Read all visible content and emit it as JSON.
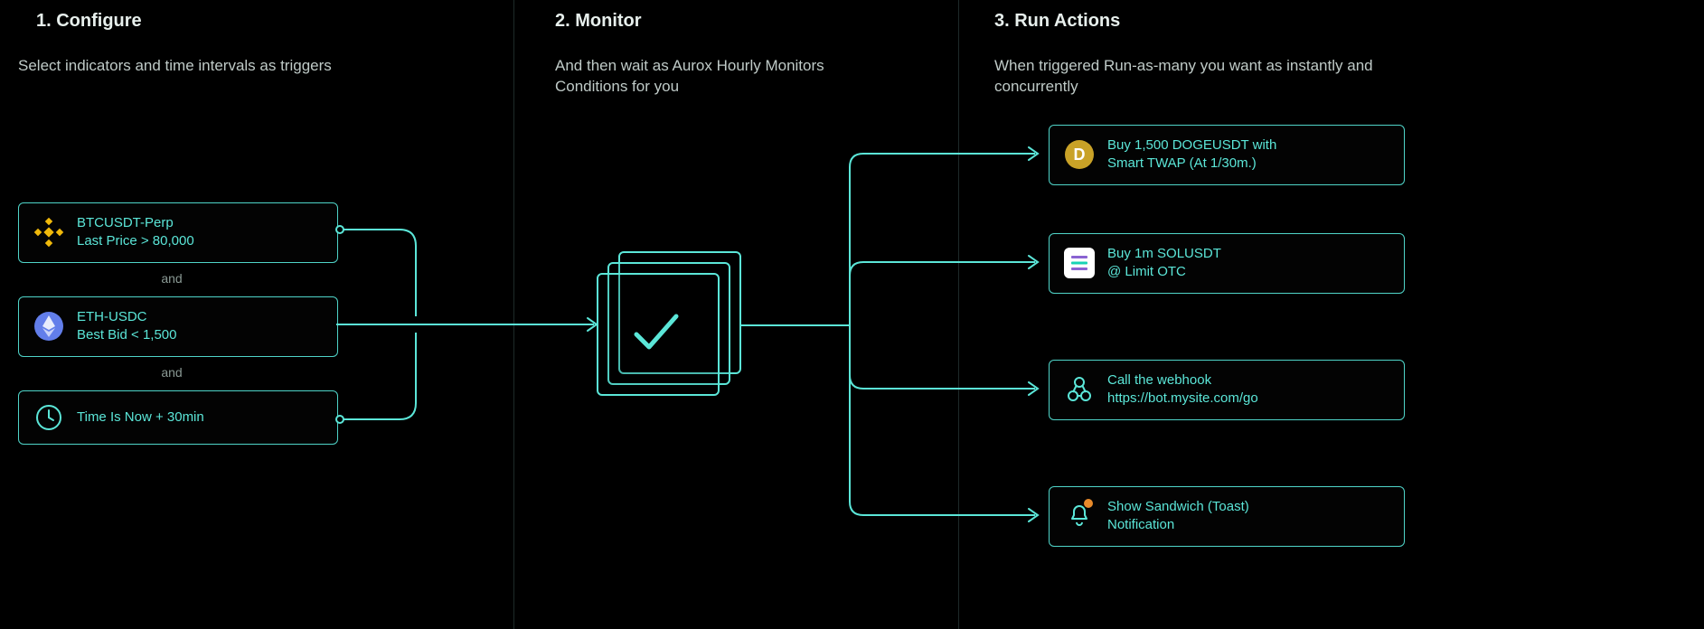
{
  "columns": {
    "c1": {
      "title": "1.   Configure",
      "sub": "Select indicators and time intervals as triggers"
    },
    "c2": {
      "title": "2.   Monitor",
      "sub": "And then wait as Aurox Hourly Monitors Conditions for you"
    },
    "c3": {
      "title": "3.   Run Actions",
      "sub": "When triggered Run-as-many you want as instantly and concurrently"
    }
  },
  "triggers": [
    {
      "line1": "BTCUSDT-Perp",
      "line2": "Last Price > 80,000",
      "icon": "binance"
    },
    {
      "line1": "ETH-USDC",
      "line2": "Best Bid < 1,500",
      "icon": "eth"
    },
    {
      "line1": "Time Is Now + 30min",
      "line2": "",
      "icon": "clock"
    }
  ],
  "join": "and",
  "actions": [
    {
      "line1": "Buy 1,500 DOGEUSDT with",
      "line2": "Smart TWAP (At 1/30m.)",
      "icon": "doge"
    },
    {
      "line1": "Buy 1m SOLUSDT",
      "line2": "@ Limit OTC",
      "icon": "sol"
    },
    {
      "line1": "Call the webhook",
      "line2": "https://bot.mysite.com/go",
      "icon": "webhook"
    },
    {
      "line1": "Show Sandwich (Toast)",
      "line2": "Notification",
      "icon": "bell"
    }
  ]
}
